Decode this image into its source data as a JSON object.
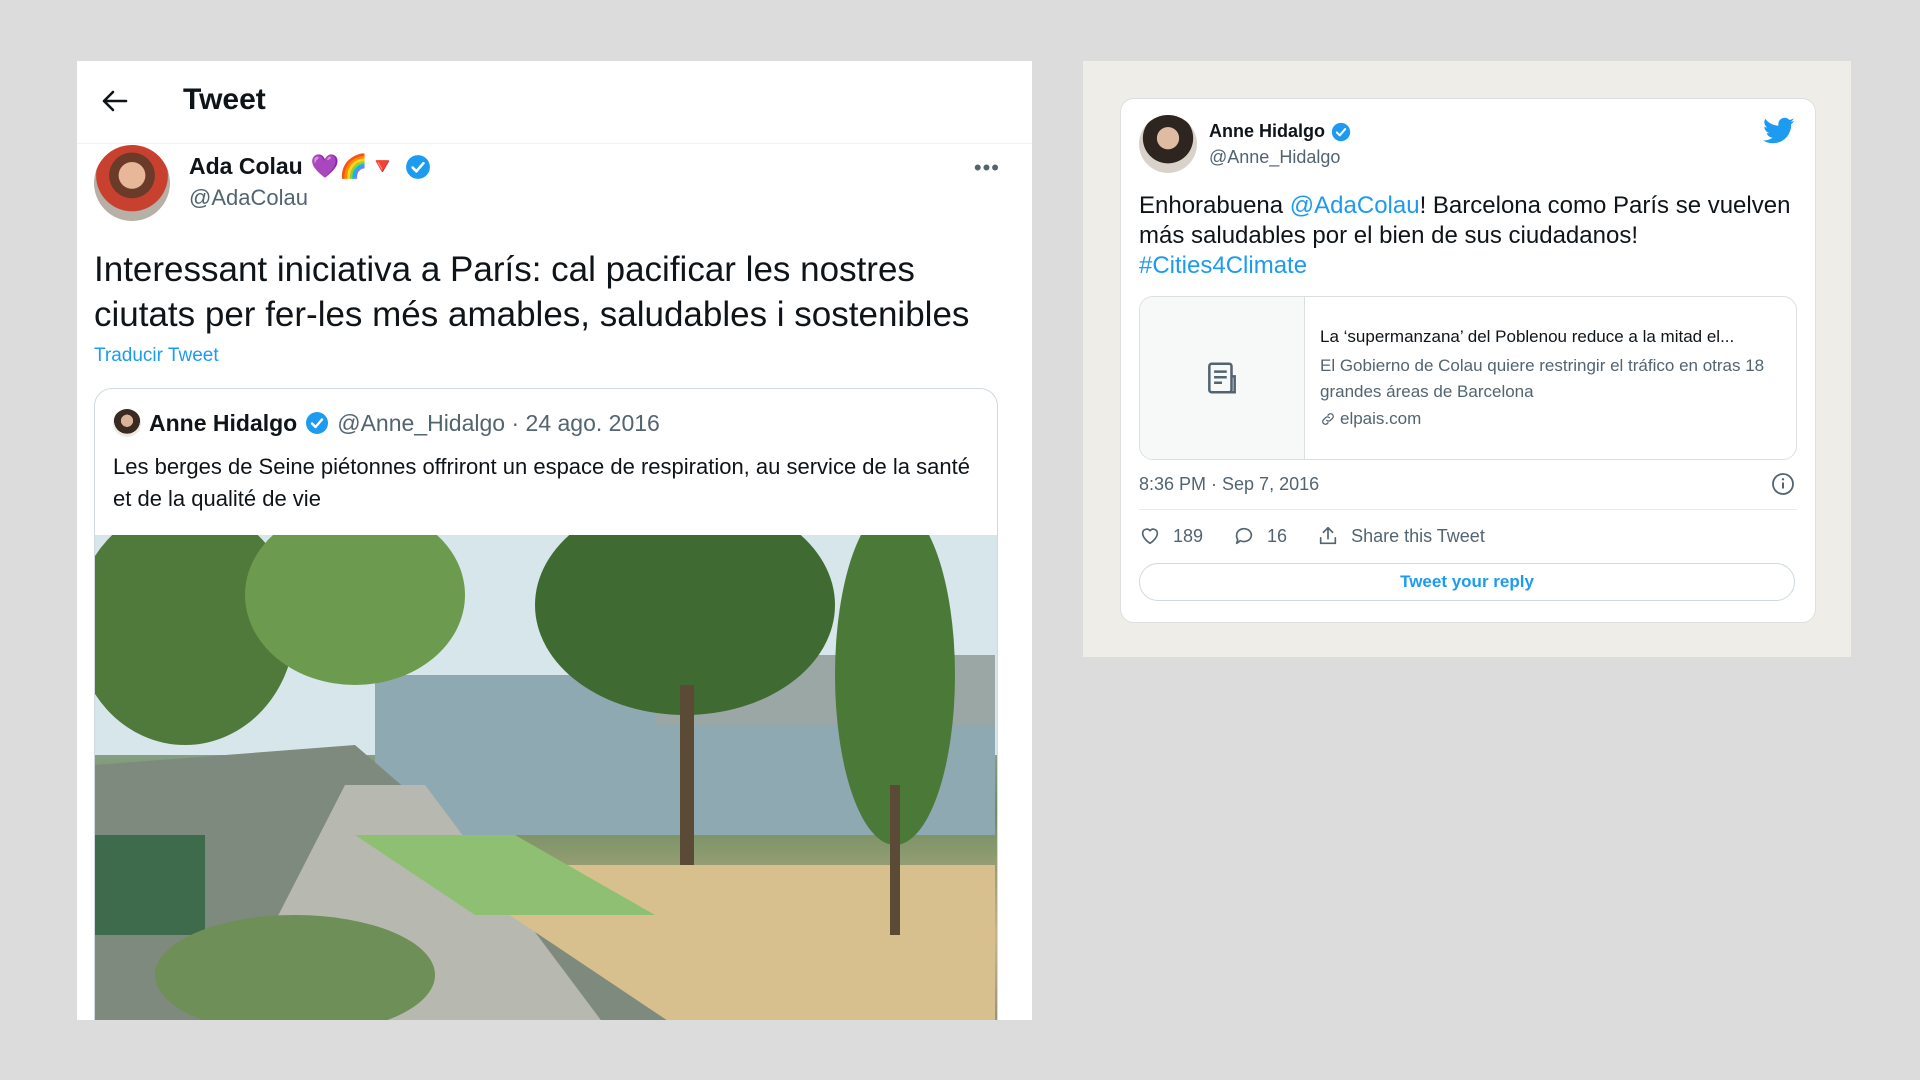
{
  "left": {
    "header_title": "Tweet",
    "author": {
      "name": "Ada Colau",
      "handle": "@AdaColau",
      "emoji": "💜🌈🔻"
    },
    "tweet_text": "Interessant iniciativa a París: cal pacificar les nostres ciutats per fer-les més amables, saludables i sostenibles",
    "translate_label": "Traducir Tweet",
    "quote": {
      "name": "Anne Hidalgo",
      "meta": "@Anne_Hidalgo · 24 ago. 2016",
      "text": "Les berges de Seine piétonnes offriront un espace de respiration, au service de la santé et de la qualité de vie"
    }
  },
  "right": {
    "author": {
      "name": "Anne Hidalgo",
      "handle": "@Anne_Hidalgo"
    },
    "text_before": "Enhorabuena ",
    "mention": "@AdaColau",
    "text_after": "! Barcelona como París se vuelven más saludables por el bien de sus ciudadanos!",
    "hashtag": "#Cities4Climate",
    "link_card": {
      "title": "La ‘supermanzana’ del Poblenou reduce a la mitad el...",
      "description": "El Gobierno de Colau quiere restringir el tráfico en otras 18 grandes áreas de Barcelona",
      "domain": "elpais.com"
    },
    "timestamp": "8:36 PM · Sep 7, 2016",
    "likes": "189",
    "replies": "16",
    "share_label": "Share this Tweet",
    "reply_button": "Tweet your reply"
  },
  "colors": {
    "accent": "#1d9bf0",
    "text": "#0f1419",
    "muted": "#536471",
    "page_bg": "#dcdcdc"
  }
}
